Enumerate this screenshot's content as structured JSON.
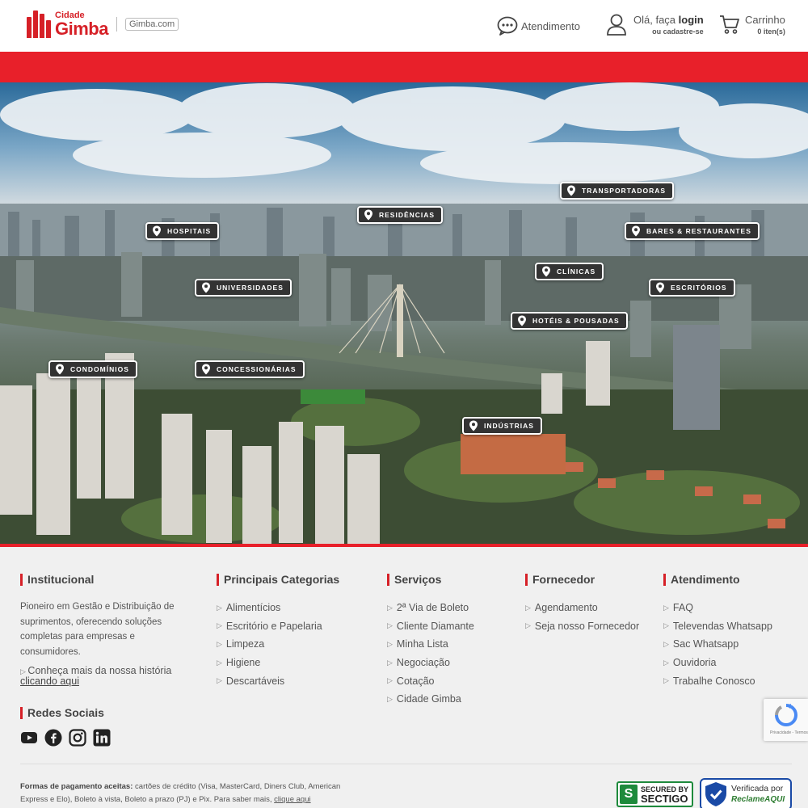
{
  "header": {
    "logo_small": "Cidade",
    "logo_big": "Gimba",
    "logo_domain": "Gimba.com",
    "atendimento_label": "Atendimento",
    "login_prefix": "Olá, faça ",
    "login_bold": "login",
    "signup_label": "ou cadastre-se",
    "cart_label": "Carrinho",
    "cart_items": "0 iten(s)",
    "icons": [
      "chat-icon",
      "user-icon",
      "cart-icon"
    ],
    "colors": {
      "brand_red": "#e8202a",
      "logo_red": "#d62027"
    }
  },
  "hero": {
    "pins": [
      {
        "id": "transportadoras",
        "label": "TRANSPORTADORAS"
      },
      {
        "id": "residencias",
        "label": "RESIDÊNCIAS"
      },
      {
        "id": "hospitais",
        "label": "HOSPITAIS"
      },
      {
        "id": "bares",
        "label": "BARES & RESTAURANTES"
      },
      {
        "id": "clinicas",
        "label": "CLÍNICAS"
      },
      {
        "id": "universidades",
        "label": "UNIVERSIDADES"
      },
      {
        "id": "escritorios",
        "label": "ESCRITÓRIOS"
      },
      {
        "id": "hoteis",
        "label": "HOTÉIS & POUSADAS"
      },
      {
        "id": "condominios",
        "label": "CONDOMÍNIOS"
      },
      {
        "id": "concessionarias",
        "label": "CONCESSIONÁRIAS"
      },
      {
        "id": "industrias",
        "label": "INDÚSTRIAS"
      }
    ]
  },
  "footer": {
    "institucional": {
      "title": "Institucional",
      "description": "Pioneiro em Gestão e Distribuição de suprimentos, oferecendo soluções completas para empresas e consumidores.",
      "more_text": "Conheça mais da nossa história",
      "more_link": "clicando aqui"
    },
    "redes": {
      "title": "Redes Sociais",
      "icons": [
        "youtube-icon",
        "facebook-icon",
        "instagram-icon",
        "linkedin-icon"
      ]
    },
    "categorias": {
      "title": "Principais Categorias",
      "items": [
        "Alimentícios",
        "Escritório e Papelaria",
        "Limpeza",
        "Higiene",
        "Descartáveis"
      ]
    },
    "servicos": {
      "title": "Serviços",
      "items": [
        "2ª Via de Boleto",
        "Cliente Diamante",
        "Minha Lista",
        "Negociação",
        "Cotação",
        "Cidade Gimba"
      ]
    },
    "fornecedor": {
      "title": "Fornecedor",
      "items": [
        "Agendamento",
        "Seja nosso Fornecedor"
      ]
    },
    "atendimento": {
      "title": "Atendimento",
      "items": [
        "FAQ",
        "Televendas Whatsapp",
        "Sac Whatsapp",
        "Ouvidoria",
        "Trabalhe Conosco"
      ]
    },
    "payment": {
      "label": "Formas de pagamento aceitas:",
      "text": " cartões de crédito (Visa, MasterCard, Diners Club, American Express e Elo), Boleto à vista, Boleto a prazo (PJ) e Pix. Para saber mais, ",
      "link": "clique aqui"
    },
    "badges": {
      "sectigo_top": "SECURED BY",
      "sectigo_bottom": "SECTIGO",
      "reclame_top": "Verificada por",
      "reclame_bottom": "ReclameAQUI"
    },
    "recaptcha_text": "Privacidade - Termos"
  }
}
